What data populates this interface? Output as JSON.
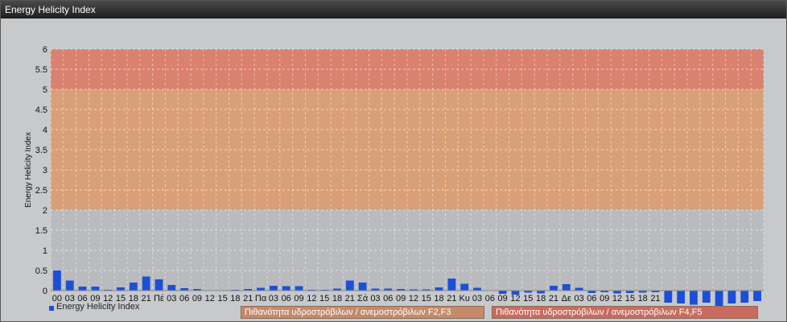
{
  "window": {
    "title": "Energy Helicity Index"
  },
  "legend": {
    "series_label": "Energy Helicity Index",
    "band_1_label": "Πιθανότητα υδροστρόβιλων / ανεμοστρόβιλων F2,F3",
    "band_2_label": "Πιθανότητα υδροστρόβιλων / ανεμοστρόβιλων F4,F5"
  },
  "chart_data": {
    "type": "bar",
    "title": "",
    "ylabel": "Energy Helicity Index",
    "xlabel": "",
    "ylim": [
      0,
      6
    ],
    "yticks": [
      "0",
      "0.5",
      "1",
      "1.5",
      "2",
      "2.5",
      "3",
      "3.5",
      "4",
      "4.5",
      "5",
      "5.5",
      "6"
    ],
    "grid": true,
    "legend_position": "bottom-left",
    "bands": [
      {
        "from": 2,
        "to": 5,
        "color": "#d9a077"
      },
      {
        "from": 5,
        "to": 6,
        "color": "#d9826f"
      }
    ],
    "categories": [
      "00",
      "03",
      "06",
      "09",
      "12",
      "15",
      "18",
      "21",
      "Πέ",
      "03",
      "06",
      "09",
      "12",
      "15",
      "18",
      "21",
      "Πα",
      "03",
      "06",
      "09",
      "12",
      "15",
      "18",
      "21",
      "Σά",
      "03",
      "06",
      "09",
      "12",
      "15",
      "18",
      "21",
      "Κυ",
      "03",
      "06",
      "09",
      "12",
      "15",
      "18",
      "21",
      "Δε",
      "03",
      "06",
      "09",
      "12",
      "15",
      "18",
      "21",
      "",
      "",
      "",
      "",
      "",
      "",
      "",
      ""
    ],
    "series": [
      {
        "name": "Energy Helicity Index",
        "color": "#1c4fd8",
        "values": [
          0.5,
          0.25,
          0.1,
          0.1,
          0.02,
          0.08,
          0.2,
          0.35,
          0.28,
          0.14,
          0.06,
          0.04,
          0.01,
          0.01,
          0.02,
          0.04,
          0.07,
          0.12,
          0.11,
          0.11,
          0.02,
          0.02,
          0.05,
          0.25,
          0.2,
          0.05,
          0.05,
          0.04,
          0.03,
          0.03,
          0.08,
          0.3,
          0.17,
          0.07,
          0.01,
          -0.08,
          -0.1,
          -0.05,
          -0.07,
          0.12,
          0.16,
          0.07,
          -0.06,
          -0.04,
          -0.07,
          -0.06,
          -0.05,
          -0.04,
          -0.3,
          -0.32,
          -0.35,
          -0.3,
          -0.4,
          -0.32,
          -0.3,
          -0.26
        ]
      }
    ]
  }
}
